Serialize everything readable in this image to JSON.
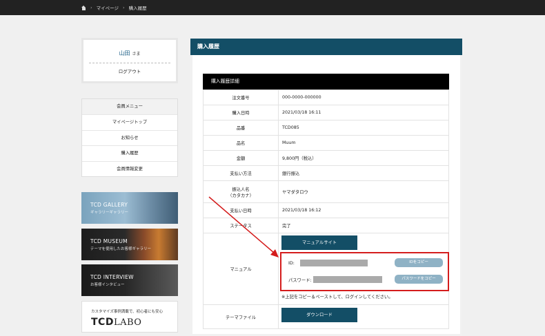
{
  "breadcrumb": {
    "mypage": "マイページ",
    "current": "購入履歴"
  },
  "user": {
    "name": "山田",
    "honorific": "さま",
    "logout": "ログアウト"
  },
  "menu": {
    "heading": "会員メニュー",
    "items": [
      "マイページトップ",
      "お知らせ",
      "購入履歴",
      "会員情報変更"
    ]
  },
  "banners": [
    {
      "title": "TCD GALLERY",
      "sub": "ギャラリーギャラリー"
    },
    {
      "title": "TCD MUSEUM",
      "sub": "テーマを使用したお客様ギャラリー"
    },
    {
      "title": "TCD INTERVIEW",
      "sub": "お客様インタビュー"
    }
  ],
  "labo": {
    "tagline": "カスタマイズ事例満載で、初心者にも安心",
    "logo_bold": "TCD",
    "logo_thin": "LABO"
  },
  "main": {
    "title": "購入履歴",
    "caption": "購入履歴詳細"
  },
  "details": [
    {
      "label": "注文番号",
      "value": "000-0000-000000"
    },
    {
      "label": "購入日時",
      "value": "2021/03/18 16:11"
    },
    {
      "label": "品番",
      "value": "TCD085"
    },
    {
      "label": "品名",
      "value": "Muum"
    },
    {
      "label": "金額",
      "value": "9,800円（税込）"
    },
    {
      "label": "支払い方法",
      "value": "銀行振込"
    },
    {
      "label": "振込人名",
      "label2": "（カタカナ）",
      "value": "ヤマダタロウ"
    },
    {
      "label": "支払い日時",
      "value": "2021/03/18 16:12"
    },
    {
      "label": "ステータス",
      "value": "完了"
    }
  ],
  "manual": {
    "label": "マニュアル",
    "site_button": "マニュアルサイト",
    "id_label": "ID:",
    "id_copy": "IDをコピー",
    "pw_label": "パスワード:",
    "pw_copy": "パスワードをコピー",
    "note": "※上記をコピー＆ペーストして、ログインしてください。"
  },
  "theme": {
    "label": "テーマファイル",
    "button": "ダウンロード"
  },
  "colors": {
    "accent": "#134e66",
    "highlight": "#d41c1c"
  }
}
